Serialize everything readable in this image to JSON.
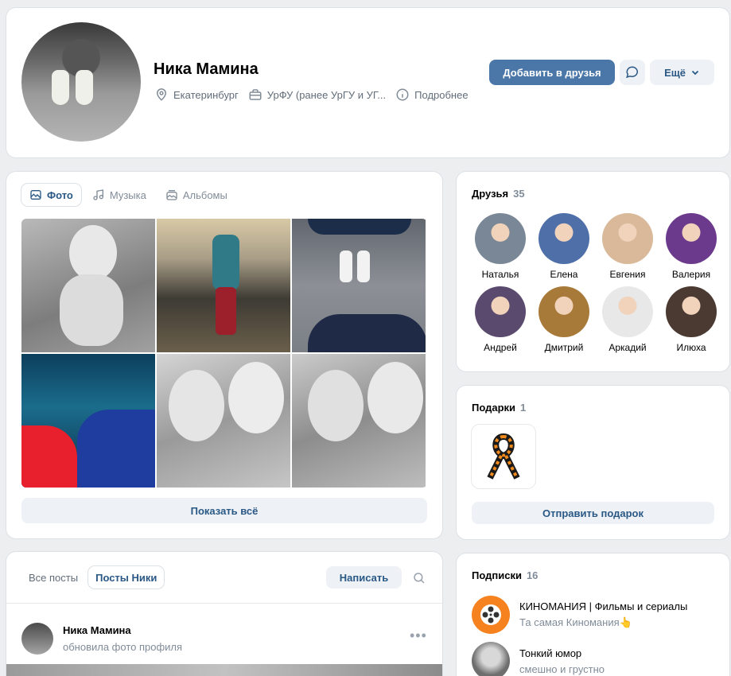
{
  "profile": {
    "name": "Ника Мамина",
    "city": "Екатеринбург",
    "university": "УрФУ (ранее УрГУ и УГ...",
    "details": "Подробнее",
    "add_friend": "Добавить в друзья",
    "more": "Ещё"
  },
  "media": {
    "tabs": [
      {
        "label": "Фото",
        "icon": "photo-icon"
      },
      {
        "label": "Музыка",
        "icon": "music-icon"
      },
      {
        "label": "Альбомы",
        "icon": "albums-icon"
      }
    ],
    "show_all": "Показать всё"
  },
  "friends": {
    "title": "Друзья",
    "count": "35",
    "list": [
      {
        "name": "Наталья",
        "color": "#7a8796"
      },
      {
        "name": "Елена",
        "color": "#4e6fa8"
      },
      {
        "name": "Евгения",
        "color": "#d9b99a"
      },
      {
        "name": "Валерия",
        "color": "#6b3a8c"
      },
      {
        "name": "Андрей",
        "color": "#5a4a6e"
      },
      {
        "name": "Дмитрий",
        "color": "#a87a3a"
      },
      {
        "name": "Аркадий",
        "color": "#e8e8e8"
      },
      {
        "name": "Илюха",
        "color": "#4a3a32"
      }
    ]
  },
  "gifts": {
    "title": "Подарки",
    "count": "1",
    "send": "Отправить подарок"
  },
  "subs": {
    "title": "Подписки",
    "count": "16",
    "items": [
      {
        "title": "КИНОМАНИЯ | Фильмы и сериалы",
        "subtitle": "Та самая Киномания👆",
        "color": "#f5821f"
      },
      {
        "title": "Тонкий юмор",
        "subtitle": "смешно и грустно",
        "color": "#8a8a8a"
      }
    ]
  },
  "wall": {
    "tab_all": "Все посты",
    "tab_own": "Посты Ники",
    "write": "Написать",
    "post_author": "Ника Мамина",
    "post_action": "обновила фото профиля",
    "menu": "•••"
  }
}
